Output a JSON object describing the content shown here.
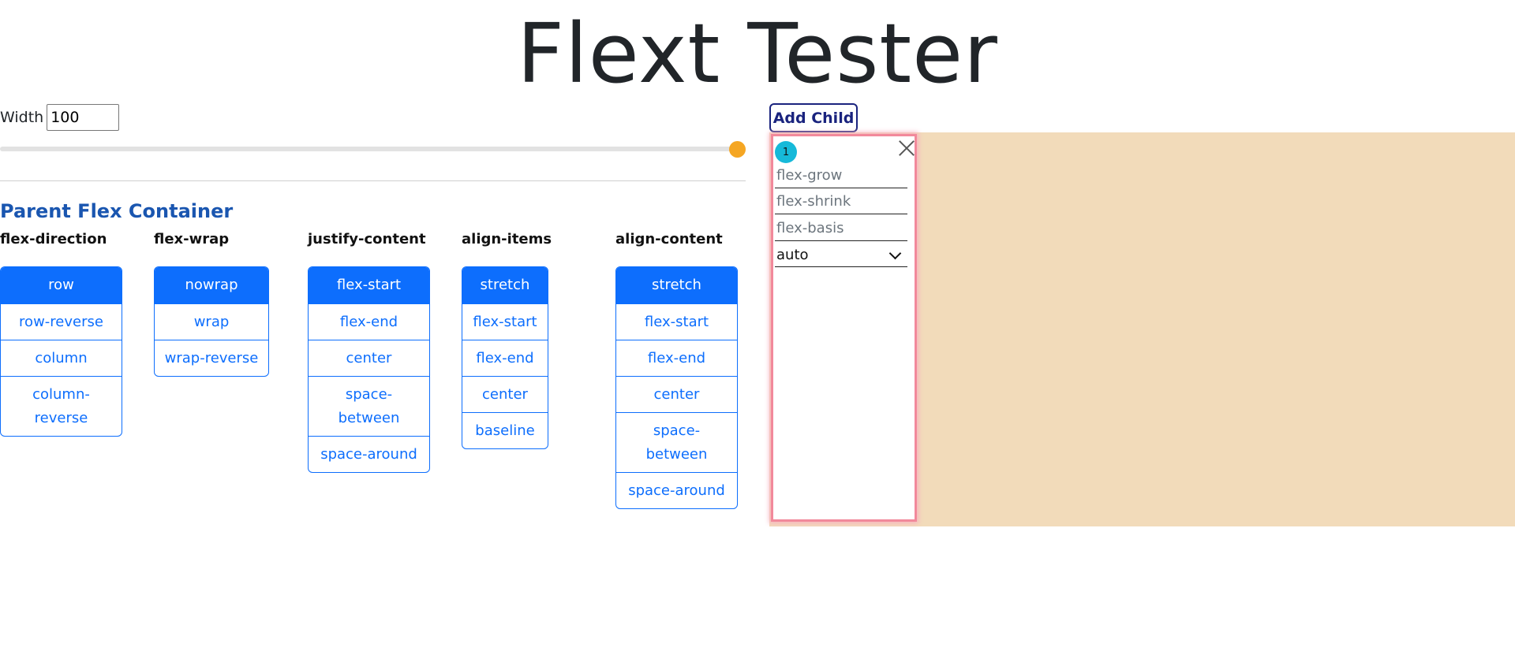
{
  "page_title": "Flext Tester",
  "width_control": {
    "label": "Width",
    "value": "100",
    "slider_value": 100
  },
  "parent_section_title": "Parent Flex Container",
  "groups": [
    {
      "label": "flex-direction",
      "options": [
        "row",
        "row-reverse",
        "column",
        "column-reverse"
      ],
      "active": "row"
    },
    {
      "label": "flex-wrap",
      "options": [
        "nowrap",
        "wrap",
        "wrap-reverse"
      ],
      "active": "nowrap"
    },
    {
      "label": "justify-content",
      "options": [
        "flex-start",
        "flex-end",
        "center",
        "space-between",
        "space-around"
      ],
      "active": "flex-start"
    },
    {
      "label": "align-items",
      "options": [
        "stretch",
        "flex-start",
        "flex-end",
        "center",
        "baseline"
      ],
      "active": "stretch"
    },
    {
      "label": "align-content",
      "options": [
        "stretch",
        "flex-start",
        "flex-end",
        "center",
        "space-between",
        "space-around"
      ],
      "active": "stretch"
    }
  ],
  "add_child_label": "Add Child",
  "child": {
    "index": "1",
    "grow_placeholder": "flex-grow",
    "shrink_placeholder": "flex-shrink",
    "basis_placeholder": "flex-basis",
    "align_self_value": "auto"
  },
  "colors": {
    "primary": "#0d6efd",
    "container_bg": "#f2dbba",
    "child_border": "#f2899b",
    "index_badge": "#16b9d9",
    "slider_thumb": "#f5a623"
  }
}
